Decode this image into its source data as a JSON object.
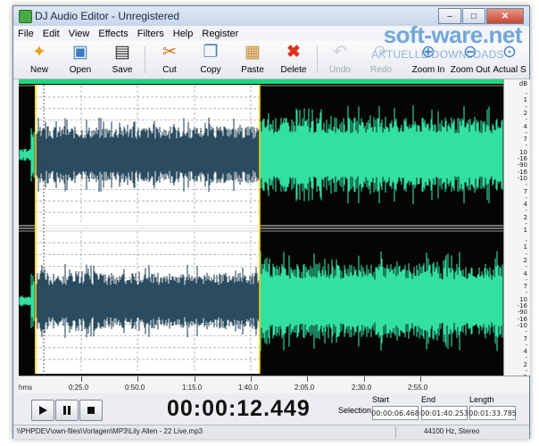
{
  "window": {
    "title": "DJ Audio Editor - Unregistered"
  },
  "title_buttons": {
    "minimize": "–",
    "maximize": "□",
    "close": "✕"
  },
  "menu": [
    "File",
    "Edit",
    "View",
    "Effects",
    "Filters",
    "Help",
    "Register"
  ],
  "toolbar": {
    "new": "New",
    "open": "Open",
    "save": "Save",
    "cut": "Cut",
    "copy": "Copy",
    "paste": "Paste",
    "delete": "Delete",
    "undo": "Undo",
    "redo": "Redo",
    "zoom_in": "Zoom In",
    "zoom_out": "Zoom Out",
    "actual_size": "Actual S"
  },
  "watermark": {
    "main": "soft-ware.net",
    "sub": "AKTUELLE DOWNLOADS"
  },
  "scale": {
    "unit": "dB",
    "upper": [
      "-",
      "1",
      "-",
      "2",
      "-",
      "4",
      "-",
      "7",
      "-",
      "10",
      "-16",
      "-90",
      "-16",
      "-10",
      "-",
      "7",
      "-",
      "4",
      "-",
      "2",
      "-",
      "1"
    ],
    "lower": [
      "-",
      "1",
      "-",
      "2",
      "-",
      "4",
      "-",
      "7",
      "-",
      "10",
      "-16",
      "-90",
      "-16",
      "-10",
      "-",
      "7",
      "-",
      "4",
      "-",
      "2",
      "-",
      "1"
    ]
  },
  "timeline": {
    "unit": "hms",
    "ticks": [
      "0:25.0",
      "0:50.0",
      "1:15.0",
      "1:40.0",
      "2:05.0",
      "2:30.0",
      "2:55.0"
    ]
  },
  "transport": {
    "time": "00:00:12.449"
  },
  "selection": {
    "label": "Selection",
    "start_label": "Start",
    "start": "00:00:06.468",
    "end_label": "End",
    "end": "00:01:40.253",
    "length_label": "Length",
    "length": "00:01:33.785"
  },
  "status": {
    "path": "\\\\PHPDEV\\own-files\\Vorlagen\\MP3\\Lily Allen - 22 Live.mp3",
    "format": "44100 Hz, Stereo"
  },
  "colors": {
    "wave_selected": "#2b4c60",
    "wave_unselected": "#32e0a2",
    "background": "#050505",
    "selection_bg": "#ffffff"
  }
}
